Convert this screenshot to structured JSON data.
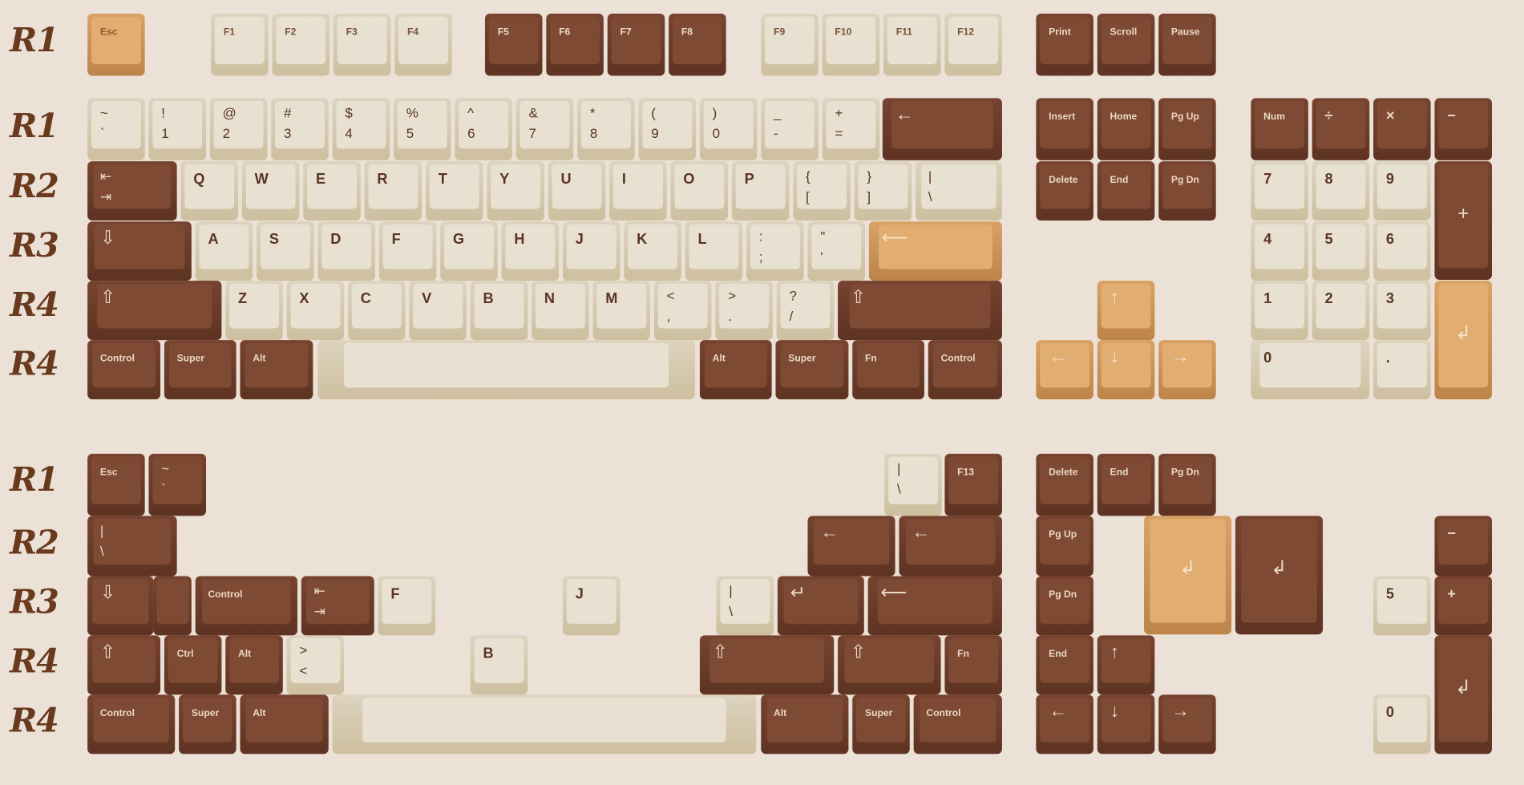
{
  "row_labels": {
    "m1": "R1",
    "m2": "R1",
    "m3": "R2",
    "m4": "R3",
    "m5": "R4",
    "m6": "R4",
    "e1": "R1",
    "e2": "R2",
    "e3": "R3",
    "e4": "R4",
    "e5": "R4"
  },
  "colors": {
    "brown": "#7f4a34",
    "cream": "#e8e1d2",
    "tan": "#e1ad70",
    "background": "#ece1d6",
    "label": "#6a3a1e"
  },
  "keys": {
    "esc": "Esc",
    "f1": "F1",
    "f2": "F2",
    "f3": "F3",
    "f4": "F4",
    "f5": "F5",
    "f6": "F6",
    "f7": "F7",
    "f8": "F8",
    "f9": "F9",
    "f10": "F10",
    "f11": "F11",
    "f12": "F12",
    "print": "Print",
    "scroll": "Scroll",
    "pause": "Pause",
    "grave": "~\n`",
    "n1": "!\n1",
    "n2": "@\n2",
    "n3": "#\n3",
    "n4": "$\n4",
    "n5": "%\n5",
    "n6": "^\n6",
    "n7": "&\n7",
    "n8": "*\n8",
    "n9": "(\n9",
    "n0": ")\n0",
    "minus": "_\n-",
    "equal": "+\n=",
    "backspace": "←",
    "insert": "Insert",
    "home": "Home",
    "pgup": "Pg Up",
    "num": "Num",
    "divide": "÷",
    "multiply": "×",
    "numminus": "−",
    "tab": "⇤\n⇥",
    "q": "Q",
    "w": "W",
    "e": "E",
    "r": "R",
    "t": "T",
    "y": "Y",
    "u": "U",
    "i": "I",
    "o": "O",
    "p": "P",
    "lbracket": "{\n[",
    "rbracket": "}\n]",
    "backslash": "|\n\\",
    "delete": "Delete",
    "end": "End",
    "pgdn": "Pg Dn",
    "num7": "7",
    "num8": "8",
    "num9": "9",
    "numplus": "+",
    "caps": "⇩",
    "a": "A",
    "s": "S",
    "d": "D",
    "f": "F",
    "g": "G",
    "h": "H",
    "j": "J",
    "k": "K",
    "l": "L",
    "semicolon": ":\n;",
    "quote": "\"\n'",
    "enter": "⟵",
    "num4": "4",
    "num5": "5",
    "num6": "6",
    "shift": "⇧",
    "z": "Z",
    "x": "X",
    "c": "C",
    "v": "V",
    "b": "B",
    "n": "N",
    "m": "M",
    "comma": "<\n,",
    "period": ">\n.",
    "slash": "?\n/",
    "up": "↑",
    "num1": "1",
    "num2": "2",
    "num3": "3",
    "numenter": "↲",
    "control": "Control",
    "super": "Super",
    "alt": "Alt",
    "fn": "Fn",
    "left": "←",
    "down": "↓",
    "right": "→",
    "num0": "0",
    "numdot": ".",
    "f13": "F13",
    "ctrl": "Ctrl",
    "angle": ">\n<",
    "enter_short": "↵",
    "enter_long": "⟵",
    "iso_enter": "↲"
  }
}
